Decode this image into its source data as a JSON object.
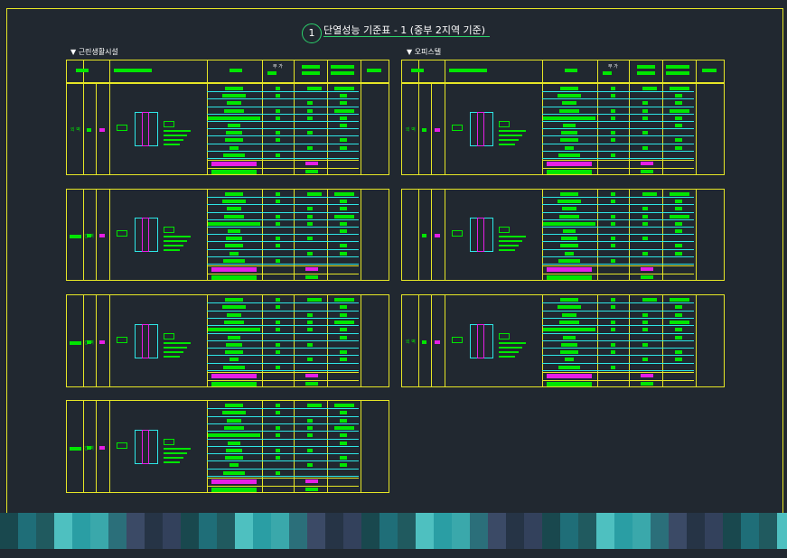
{
  "drawing": {
    "circle_number": "1",
    "title": "단열성능 기준표 - 1 (중부 2지역 기준)",
    "section_left": "▼ 근린생활시설",
    "section_right": "▼ 오피스텔",
    "header_note": "부 가"
  },
  "panels": [
    {
      "id": "L1",
      "side": "left",
      "row_label": "외 벽",
      "group_label": ""
    },
    {
      "id": "L2",
      "side": "left",
      "row_label": "",
      "group_label": "간 벽"
    },
    {
      "id": "L3",
      "side": "left",
      "row_label": "",
      "group_label": "간 벽"
    },
    {
      "id": "L4",
      "side": "left",
      "row_label": "",
      "group_label": "간 벽"
    },
    {
      "id": "R1",
      "side": "right",
      "row_label": "외 벽",
      "group_label": ""
    },
    {
      "id": "R2",
      "side": "right",
      "row_label": "",
      "group_label": ""
    },
    {
      "id": "R3",
      "side": "right",
      "row_label": "외 벽",
      "group_label": ""
    }
  ],
  "colors": {
    "frame": "#e6e626",
    "fill_green": "#00e600",
    "fill_magenta": "#e61ee6",
    "line_cyan": "#2ee6e6",
    "background": "#212830"
  }
}
